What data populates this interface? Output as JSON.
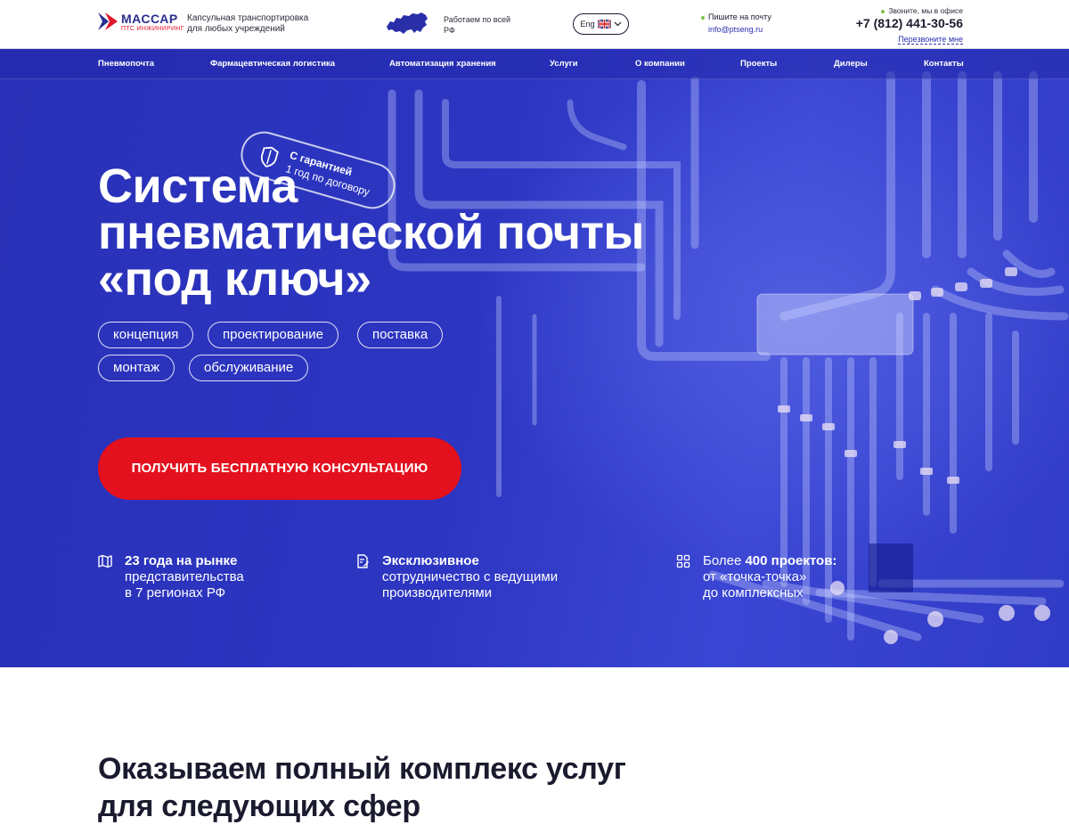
{
  "header": {
    "logo": {
      "name": "МАССАР",
      "subtitle": "ПТС ИНЖИНИРИНГ"
    },
    "tagline": "Капсульная транспортировка для любых учреждений",
    "works": "Работаем по всей РФ",
    "language": {
      "label": "Eng",
      "icon": "uk-flag-icon"
    },
    "mail": {
      "note": "Пишите на почту",
      "email": "info@ptseng.ru"
    },
    "phone": {
      "note": "Звоните, мы в офисе",
      "number": "+7 (812) 441-30-56",
      "callback": "Перезвоните мне"
    }
  },
  "nav": {
    "items": [
      "Пневмопочта",
      "Фармацевтическая логистика",
      "Автоматизация хранения",
      "Услуги",
      "О компании",
      "Проекты",
      "Дилеры",
      "Контакты"
    ]
  },
  "hero": {
    "guarantee": {
      "line1": "С гарантией",
      "line2": "1 год по договору"
    },
    "title": "Система пневматической почты «под ключ»",
    "chips": [
      "концепция",
      "проектирование",
      "поставка",
      "монтаж",
      "обслуживание"
    ],
    "cta": "ПОЛУЧИТЬ БЕСПЛАТНУЮ КОНСУЛЬТАЦИЮ",
    "facts": [
      {
        "icon": "map-book-icon",
        "bold": "23 года на рынке",
        "line2": "представительства",
        "line3": "в 7 регионах РФ"
      },
      {
        "icon": "document-edit-icon",
        "bold": "Эксклюзивное",
        "line2": "сотрудничество с ведущими",
        "line3": "производителями"
      },
      {
        "icon": "grid-icon",
        "prefix": "Более ",
        "bold": "400 проектов:",
        "line2": "от «точка-точка»",
        "line3": "до комплексных"
      }
    ]
  },
  "section": {
    "title_regular": "Оказываем ",
    "title_bold": "полный комплекс услуг",
    "title_line2": "для следующих сфер"
  },
  "colors": {
    "brand_blue": "#2c36c2",
    "accent_red": "#e3101e",
    "link_blue": "#2a2fb0",
    "status_green": "#7bc144"
  }
}
